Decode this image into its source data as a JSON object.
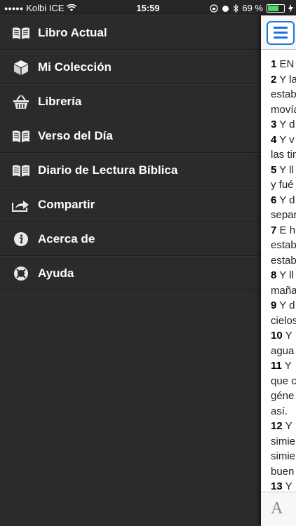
{
  "status": {
    "carrier": "Kolbi ICE",
    "time": "15:59",
    "battery": "69 %"
  },
  "menu": {
    "items": [
      {
        "label": "Libro Actual",
        "icon": "open-book-icon"
      },
      {
        "label": "Mi Colección",
        "icon": "box-icon"
      },
      {
        "label": "Librería",
        "icon": "basket-icon"
      },
      {
        "label": "Verso del Día",
        "icon": "open-book-icon"
      },
      {
        "label": "Diario de Lectura Bíblica",
        "icon": "open-book-icon"
      },
      {
        "label": "Compartir",
        "icon": "share-icon"
      },
      {
        "label": "Acerca de",
        "icon": "info-icon"
      },
      {
        "label": "Ayuda",
        "icon": "lifebuoy-icon"
      }
    ]
  },
  "reader": {
    "lines": [
      {
        "num": "1",
        "text": "EN"
      },
      {
        "num": "2",
        "text": "Y la"
      },
      {
        "num": "",
        "text": "estab"
      },
      {
        "num": "",
        "text": "movía"
      },
      {
        "num": "3",
        "text": "Y d"
      },
      {
        "num": "4",
        "text": "Y v"
      },
      {
        "num": "",
        "text": "las tin"
      },
      {
        "num": "5",
        "text": "Y ll"
      },
      {
        "num": "",
        "text": "y fué"
      },
      {
        "num": "6",
        "text": "Y d"
      },
      {
        "num": "",
        "text": "separ"
      },
      {
        "num": "7",
        "text": "E h"
      },
      {
        "num": "",
        "text": "estab"
      },
      {
        "num": "",
        "text": "estab"
      },
      {
        "num": "8",
        "text": "Y ll"
      },
      {
        "num": "",
        "text": "maña"
      },
      {
        "num": "9",
        "text": "Y d"
      },
      {
        "num": "",
        "text": "cielos"
      },
      {
        "num": "10",
        "text": "Y"
      },
      {
        "num": "",
        "text": "agua"
      },
      {
        "num": "11",
        "text": "Y"
      },
      {
        "num": "",
        "text": "que c"
      },
      {
        "num": "",
        "text": "géne"
      },
      {
        "num": "",
        "text": "así."
      },
      {
        "num": "12",
        "text": "Y"
      },
      {
        "num": "",
        "text": "simie"
      },
      {
        "num": "",
        "text": "simie"
      },
      {
        "num": "",
        "text": "buen"
      },
      {
        "num": "13",
        "text": "Y"
      }
    ],
    "font_button": "A"
  }
}
